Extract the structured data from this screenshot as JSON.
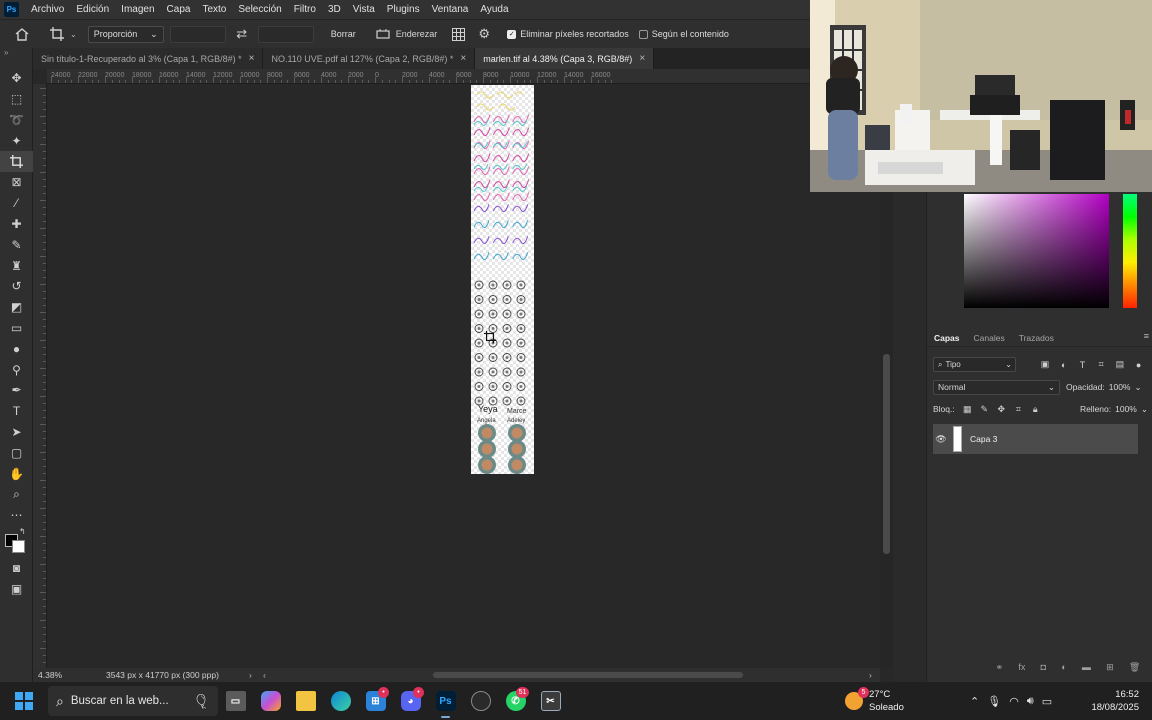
{
  "menu": {
    "logo": "Ps",
    "items": [
      "Archivo",
      "Edición",
      "Imagen",
      "Capa",
      "Texto",
      "Selección",
      "Filtro",
      "3D",
      "Vista",
      "Plugins",
      "Ventana",
      "Ayuda"
    ]
  },
  "options": {
    "ratio": "Proporción",
    "clear": "Borrar",
    "straighten": "Enderezar",
    "delete_cropped": "Eliminar píxeles recortados",
    "delete_cropped_checked": true,
    "content_aware": "Según el contenido",
    "content_aware_checked": false
  },
  "tabs": [
    {
      "label": "Sin título-1-Recuperado al 3% (Capa 1, RGB/8#) *",
      "active": false
    },
    {
      "label": "NO.110 UVE.pdf al 127% (Capa 2, RGB/8#) *",
      "active": false
    },
    {
      "label": "marlen.tif al 4.38% (Capa 3, RGB/8#)",
      "active": true
    }
  ],
  "ruler": {
    "h_ticks": [
      "24000",
      "22000",
      "20000",
      "18000",
      "16000",
      "14000",
      "12000",
      "10000",
      "8000",
      "6000",
      "4000",
      "2000",
      "0",
      "2000",
      "4000",
      "6000",
      "8000",
      "10000",
      "12000",
      "14000",
      "16000"
    ]
  },
  "document": {
    "name_labels": [
      "Yeya",
      "Angela",
      "Marce",
      "Adeley"
    ]
  },
  "status": {
    "zoom": "4.38%",
    "info": "3543 px x 41770 px (300 ppp)"
  },
  "layers": {
    "tabs": [
      "Capas",
      "Canales",
      "Trazados"
    ],
    "filter_kind": "Tipo",
    "blend_mode": "Normal",
    "opacity_label": "Opacidad:",
    "opacity": "100%",
    "lock_label": "Bloq.:",
    "fill_label": "Relleno:",
    "fill": "100%",
    "items": [
      {
        "name": "Capa 3",
        "visible": true
      }
    ]
  },
  "colors": {
    "picker_hue": "#b300c4",
    "foreground": "#000000",
    "background": "#ffffff"
  },
  "taskbar": {
    "search_placeholder": "Buscar en la web...",
    "weather_temp": "27°C",
    "weather_desc": "Soleado",
    "time": "16:52",
    "date": "18/08/2025",
    "badges": {
      "weather": "5",
      "whatsapp": "51"
    }
  }
}
